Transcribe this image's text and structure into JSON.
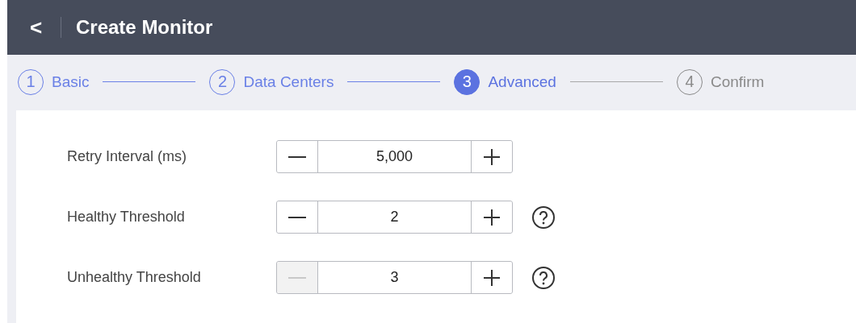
{
  "header": {
    "back_glyph": "<",
    "title": "Create Monitor"
  },
  "steps": [
    {
      "number": "1",
      "label": "Basic",
      "done": true,
      "selected": false
    },
    {
      "number": "2",
      "label": "Data Centers",
      "done": true,
      "selected": false
    },
    {
      "number": "3",
      "label": "Advanced",
      "done": false,
      "selected": true
    },
    {
      "number": "4",
      "label": "Confirm",
      "done": false,
      "selected": false
    }
  ],
  "fields": [
    {
      "label": "Retry Interval (ms)",
      "value": "5,000",
      "minus_disabled": false,
      "help": false
    },
    {
      "label": "Healthy Threshold",
      "value": "2",
      "minus_disabled": false,
      "help": true
    },
    {
      "label": "Unhealthy Threshold",
      "value": "3",
      "minus_disabled": true,
      "help": true
    }
  ]
}
